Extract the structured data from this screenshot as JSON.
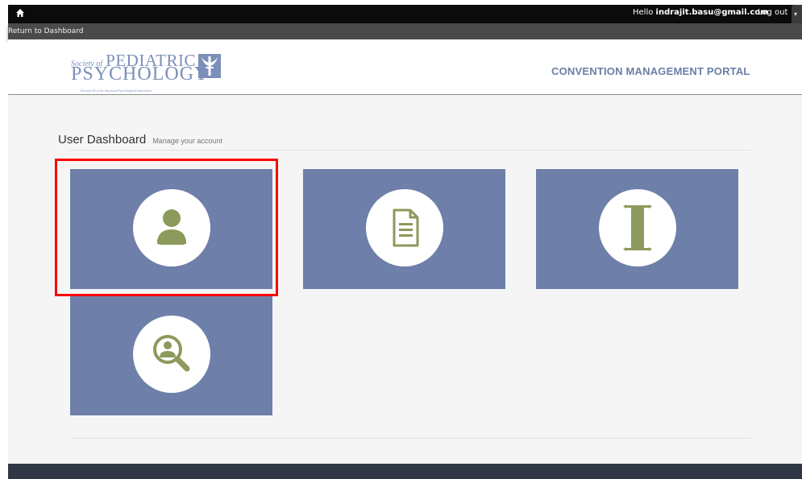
{
  "topbar": {
    "greeting_prefix": "Hello",
    "user_email": "indrajit.basu@gmail.com",
    "logout_label": "Log out",
    "home_icon": "home-icon",
    "menu_icon": "chevron-down-icon"
  },
  "subbar": {
    "return_label": "Return to Dashboard"
  },
  "header": {
    "logo": {
      "line1_small": "Society of",
      "line1_big": "PEDIATRIC",
      "line2": "PSYCHOLOGY",
      "line3": "Division 54 of the American Psychological Association"
    },
    "portal_title": "CONVENTION MANAGEMENT PORTAL"
  },
  "dashboard": {
    "title": "User Dashboard",
    "subtitle": "Manage your account",
    "tiles": [
      {
        "icon": "user-icon"
      },
      {
        "icon": "document-icon"
      },
      {
        "icon": "scroll-icon"
      },
      {
        "icon": "search-user-icon"
      }
    ]
  },
  "colors": {
    "tile_bg": "#6e80a9",
    "icon_green": "#8c9a5b",
    "highlight": "#ff0000",
    "portal_title": "#6a7fa6",
    "footer": "#303846"
  }
}
